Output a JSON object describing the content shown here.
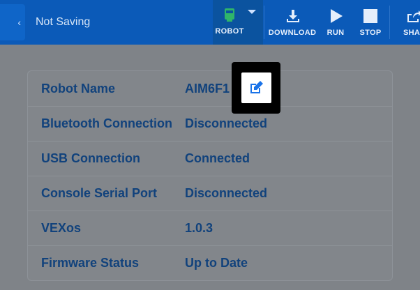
{
  "header": {
    "project_name": "Not Saving",
    "toolbar": {
      "robot_label": "ROBOT",
      "download_label": "DOWNLOAD",
      "run_label": "RUN",
      "stop_label": "STOP",
      "share_label": "SHA"
    }
  },
  "device_info": {
    "rows": [
      {
        "label": "Robot Name",
        "value": "AIM6F1"
      },
      {
        "label": "Bluetooth Connection",
        "value": "Disconnected"
      },
      {
        "label": "USB Connection",
        "value": "Connected"
      },
      {
        "label": "Console Serial Port",
        "value": "Disconnected"
      },
      {
        "label": "VEXos",
        "value": "1.0.3"
      },
      {
        "label": "Firmware Status",
        "value": "Up to Date"
      }
    ]
  },
  "icons": {
    "robot": "robot-icon",
    "download": "download-icon",
    "run": "play-icon",
    "stop": "stop-icon",
    "share": "share-icon",
    "edit": "edit-icon"
  },
  "colors": {
    "topbar": "#0b5ab8",
    "robot_icon": "#2fb56a",
    "label_text": "#11427c",
    "edit_icon": "#1a73e8"
  }
}
